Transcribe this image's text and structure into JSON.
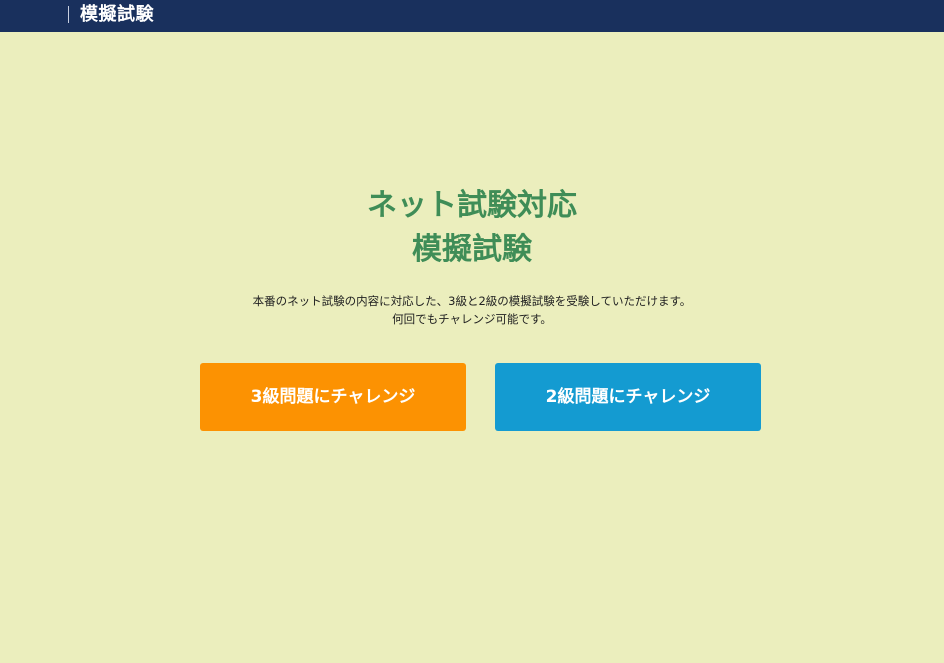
{
  "header": {
    "title": "模擬試験"
  },
  "hero": {
    "title_line1": "ネット試験対応",
    "title_line2": "模擬試験",
    "description_line1": "本番のネット試験の内容に対応した、3級と2級の模擬試験を受験していただけます。",
    "description_line2": "何回でもチャレンジ可能です。"
  },
  "buttons": {
    "grade3_label": "3級問題にチャレンジ",
    "grade2_label": "2級問題にチャレンジ"
  },
  "colors": {
    "background": "#ebeebd",
    "header": "#19305d",
    "title_green": "#3f8d57",
    "grade3_orange": "#fc9202",
    "grade2_blue": "#149bd1"
  }
}
